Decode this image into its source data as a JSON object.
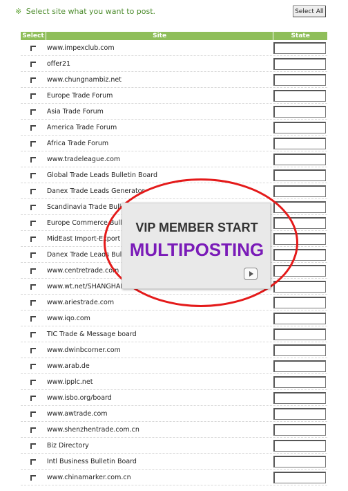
{
  "instruction": {
    "mark": "※",
    "text": "Select site what you want to post."
  },
  "select_all_label": "Select All",
  "columns": {
    "select": "Select",
    "site": "Site",
    "state": "State"
  },
  "sites": [
    "www.impexclub.com",
    "offer21",
    "www.chungnambiz.net",
    "Europe Trade Forum",
    "Asia Trade Forum",
    "America Trade Forum",
    "Africa Trade Forum",
    "www.tradeleague.com",
    "Global Trade Leads Bulletin Board",
    "Danex Trade Leads Generator",
    "Scandinavia Trade Bulletin",
    "Europe Commerce Bulletin",
    "MidEast Import-Export",
    "Danex Trade Leads Bulletin",
    "www.centretrade.com",
    "www.wt.net/SHANGHAI",
    "www.ariestrade.com",
    "www.iqo.com",
    "TIC Trade & Message board",
    "www.dwinbcorner.com",
    "www.arab.de",
    "www.ipplc.net",
    "www.isbo.org/board",
    "www.awtrade.com",
    "www.shenzhentrade.com.cn",
    "Biz Directory",
    "Intl Business Bulletin Board",
    "www.chinamarker.com.cn"
  ],
  "promo": {
    "line1": "VIP MEMBER START",
    "line2": "MULTIPOSTING",
    "line2_color": "#7a1bb8",
    "ring_color": "#e41a1a",
    "play_icon": "play-icon"
  },
  "colors": {
    "header_bg": "#8fbe5a",
    "instruction_text": "#4a8a2a"
  }
}
